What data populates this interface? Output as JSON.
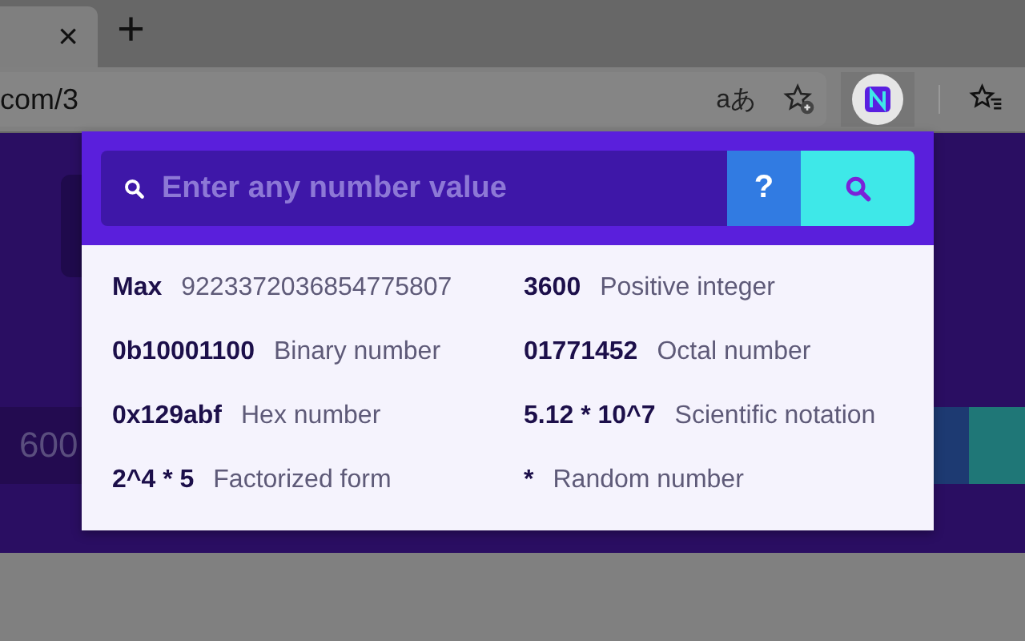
{
  "browser": {
    "tab_close": "×",
    "new_tab": "+",
    "address": "com/3",
    "translate": "aあ"
  },
  "page": {
    "field_value": "600"
  },
  "popup": {
    "search": {
      "placeholder": "Enter any number value"
    },
    "help_button": "?",
    "examples": [
      {
        "value": "Max",
        "description": "9223372036854775807"
      },
      {
        "value": "3600",
        "description": "Positive integer"
      },
      {
        "value": "0b10001100",
        "description": "Binary number"
      },
      {
        "value": "01771452",
        "description": "Octal number"
      },
      {
        "value": "0x129abf",
        "description": "Hex number"
      },
      {
        "value": "5.12 * 10^7",
        "description": "Scientific notation"
      },
      {
        "value": "2^4 * 5",
        "description": "Factorized form"
      },
      {
        "value": "*",
        "description": "Random number"
      }
    ]
  }
}
